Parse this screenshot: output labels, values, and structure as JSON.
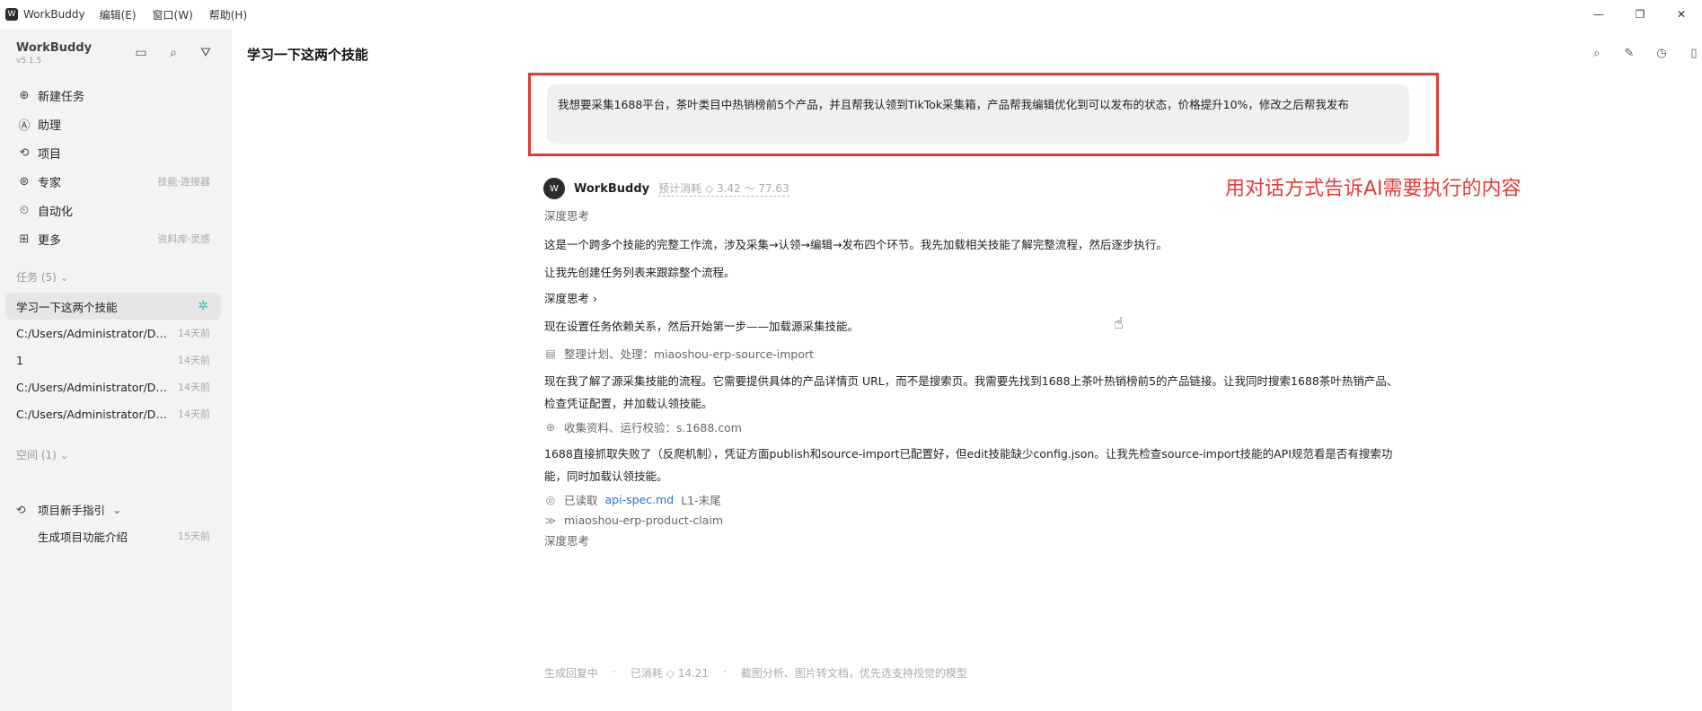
{
  "titlebar": {
    "app_name": "WorkBuddy",
    "menu": [
      "编辑(E)",
      "窗口(W)",
      "帮助(H)"
    ]
  },
  "sidebar": {
    "brand": "WorkBuddy",
    "version": "v5.1.5",
    "nav": [
      {
        "label": "新建任务",
        "icon": "plus-circle-icon",
        "meta": ""
      },
      {
        "label": "助理",
        "icon": "assistant-icon",
        "meta": ""
      },
      {
        "label": "项目",
        "icon": "project-icon",
        "meta": ""
      },
      {
        "label": "专家",
        "icon": "expert-icon",
        "meta": "技能·连接器"
      },
      {
        "label": "自动化",
        "icon": "clock-icon",
        "meta": ""
      },
      {
        "label": "更多",
        "icon": "grid-icon",
        "meta": "资料库·灵感"
      }
    ],
    "tasks_label": "任务 (5)",
    "tasks": [
      {
        "title": "学习一下这两个技能",
        "time": ""
      },
      {
        "title": "C:/Users/Administrator/Des...",
        "time": "14天前"
      },
      {
        "title": "1",
        "time": "14天前"
      },
      {
        "title": "C:/Users/Administrator/Des...",
        "time": "14天前"
      },
      {
        "title": "C:/Users/Administrator/Des...",
        "time": "14天前"
      }
    ],
    "spaces_label": "空间 (1)",
    "spaces": [
      {
        "title": "项目新手指引",
        "time": ""
      },
      {
        "title": "生成项目功能介绍",
        "time": "15天前"
      }
    ]
  },
  "main": {
    "title": "学习一下这两个技能",
    "user_message": "我想要采集1688平台，茶叶类目中热销榜前5个产品，并且帮我认领到TikTok采集箱，产品帮我编辑优化到可以发布的状态，价格提升10%，修改之后帮我发布",
    "agent_name": "WorkBuddy",
    "agent_cost": "预计消耗 ◇ 3.42 ～ 77.63",
    "annotation": "用对话方式告诉AI需要执行的内容",
    "think1": "深度思考",
    "msg1": "这是一个跨多个技能的完整工作流，涉及采集→认领→编辑→发布四个环节。我先加载相关技能了解完整流程，然后逐步执行。",
    "msg2": "让我先创建任务列表来跟踪整个流程。",
    "think2": "深度思考 ›",
    "msg3": "现在设置任务依赖关系，然后开始第一步——加载源采集技能。",
    "tool1": "整理计划、处理：miaoshou-erp-source-import",
    "msg4": "现在我了解了源采集技能的流程。它需要提供具体的产品详情页 URL，而不是搜索页。我需要先找到1688上茶叶热销榜前5的产品链接。让我同时搜索1688茶叶热销产品、检查凭证配置，并加载认领技能。",
    "tool2": "收集资料、运行校验：s.1688.com",
    "msg5": "1688直接抓取失败了（反爬机制），凭证方面publish和source-import已配置好，但edit技能缺少config.json。让我先检查source-import技能的API规范看是否有搜索功能，同时加载认领技能。",
    "tool3_prefix": "已读取",
    "tool3_link": "api-spec.md",
    "tool3_suffix": "L1-末尾",
    "tool4": "miaoshou-erp-product-claim",
    "think3": "深度思考",
    "status": [
      "生成回复中",
      "·",
      "已消耗 ◇ 14.21",
      "·",
      "截图分析、图片转文档，优先选支持视觉的模型"
    ]
  },
  "colors": {
    "annotation_red": "#e63a3a",
    "sidebar_bg": "#f3f3f3",
    "spark_teal": "#33c3b8",
    "link_blue": "#2a6fd8"
  }
}
